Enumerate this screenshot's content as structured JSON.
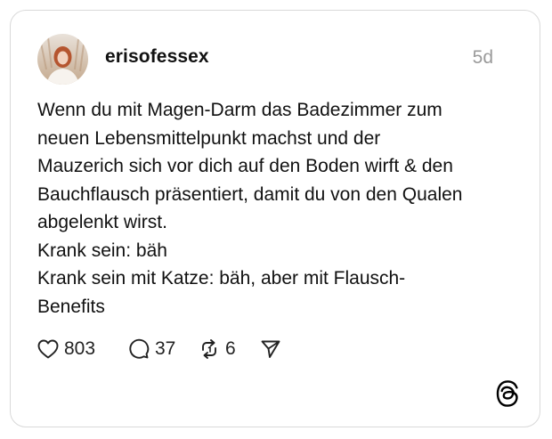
{
  "post": {
    "username": "erisofessex",
    "timestamp": "5d",
    "text": "Wenn du mit Magen-Darm das Badezimmer zum\nneuen Lebensmittelpunkt machst und der\nMauzerich sich vor dich auf den Boden wirft & den\nBauchflausch präsentiert, damit du von den Qualen\nabgelenkt wirst.\nKrank sein: bäh\nKrank sein mit Katze: bäh, aber mit Flausch-\nBenefits"
  },
  "actions": {
    "likes": "803",
    "replies": "37",
    "reposts": "6"
  },
  "icons": {
    "like": "heart-icon",
    "reply": "comment-bubble-icon",
    "repost": "repost-icon",
    "share": "send-icon",
    "brand": "threads-logo-icon"
  }
}
